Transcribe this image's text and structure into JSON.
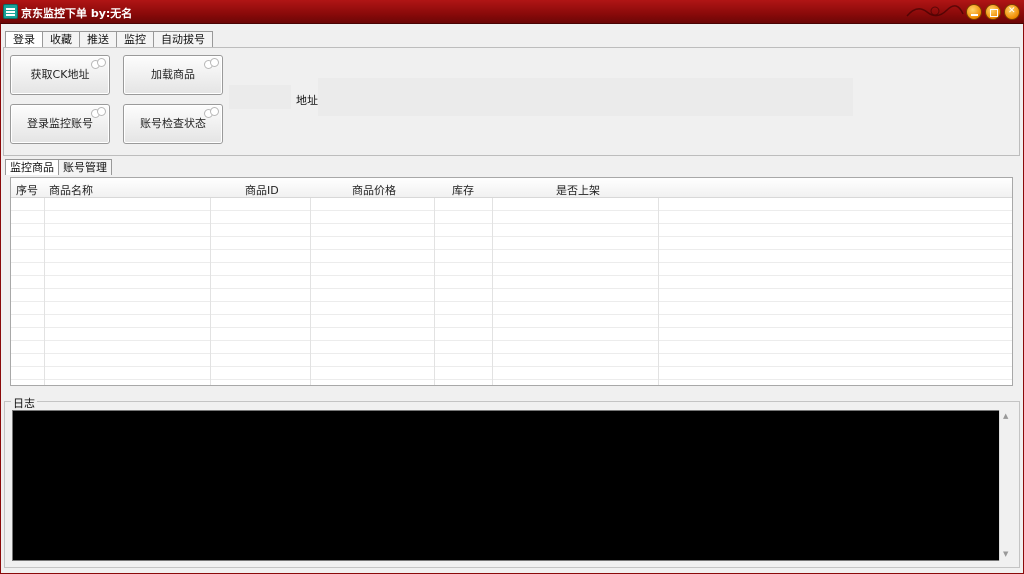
{
  "window": {
    "title": "京东监控下单  by:无名",
    "controls": [
      "minimize-icon",
      "maximize-icon",
      "close-icon"
    ],
    "accent": "#8a0a0a"
  },
  "tabs": [
    {
      "label": "登录",
      "active": true
    },
    {
      "label": "收藏",
      "active": false
    },
    {
      "label": "推送",
      "active": false
    },
    {
      "label": "监控",
      "active": false
    },
    {
      "label": "自动拔号",
      "active": false
    }
  ],
  "login_panel": {
    "get_ck_button": "获取CK地址",
    "load_goods_button": "加载商品",
    "login_monitor_button": "登录监控账号",
    "check_account_button": "账号检查状态",
    "address_label": "地址:",
    "address_value": ""
  },
  "subtabs": [
    {
      "label": "监控商品",
      "active": true
    },
    {
      "label": "账号管理",
      "active": false
    }
  ],
  "goods_table": {
    "columns": [
      "序号",
      "商品名称",
      "商品ID",
      "商品价格",
      "库存",
      "是否上架"
    ],
    "rows": []
  },
  "log": {
    "label": "日志",
    "content": ""
  }
}
